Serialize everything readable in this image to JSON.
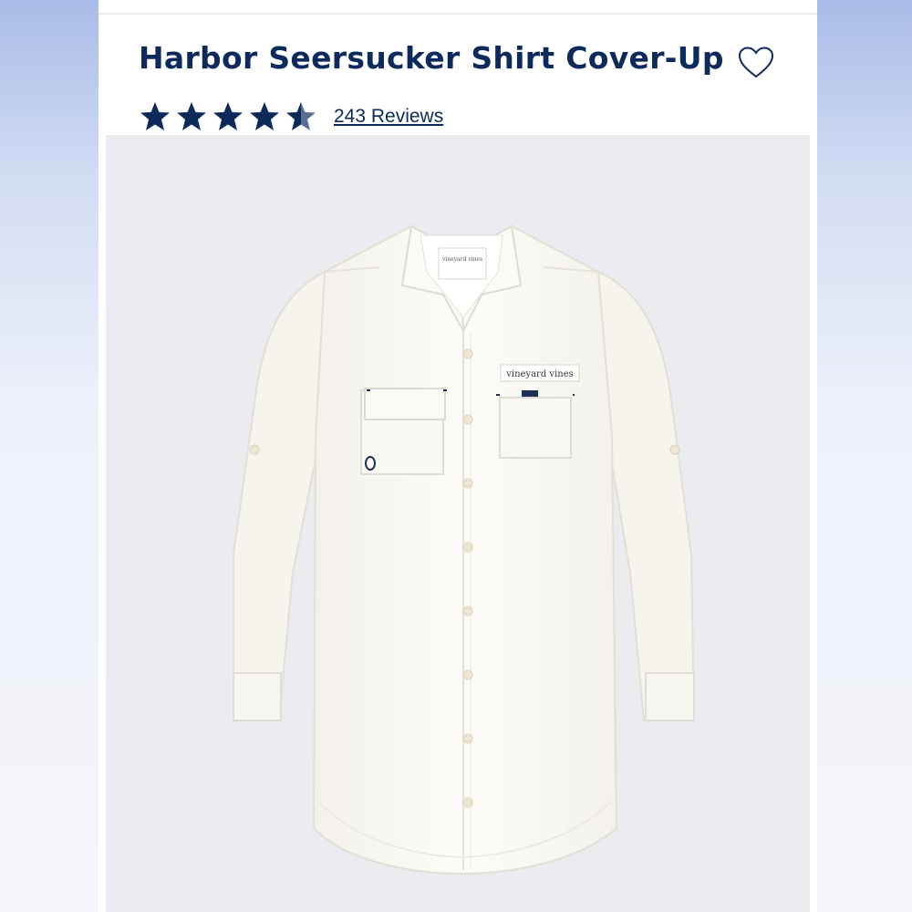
{
  "product": {
    "title": "Harbor Seersucker Shirt Cover-Up",
    "rating": 4.5,
    "rating_max": 5,
    "reviews_label": "243 Reviews"
  },
  "icons": {
    "favorite": "heart-outline-icon",
    "star": "star-icon"
  },
  "image": {
    "chest_label_text": "vineyard vines",
    "neck_label_text": "vineyard vines"
  },
  "colors": {
    "brand_navy": "#0d2a5c",
    "image_background": "#ebecef",
    "shirt": "#fbf9f3"
  }
}
